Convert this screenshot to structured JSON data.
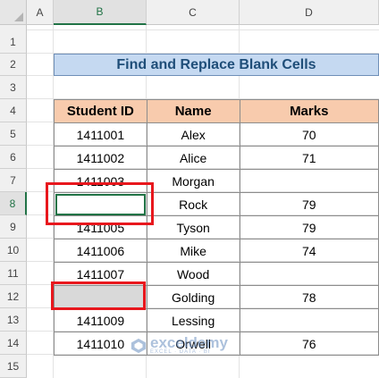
{
  "columns": [
    "A",
    "B",
    "C",
    "D"
  ],
  "rows": [
    "1",
    "2",
    "3",
    "4",
    "5",
    "6",
    "7",
    "8",
    "9",
    "10",
    "11",
    "12",
    "13",
    "14",
    "15"
  ],
  "title": "Find and Replace Blank Cells",
  "table": {
    "headers": [
      "Student ID",
      "Name",
      "Marks"
    ],
    "rows": [
      [
        "1411001",
        "Alex",
        "70"
      ],
      [
        "1411002",
        "Alice",
        "71"
      ],
      [
        "1411003",
        "Morgan",
        ""
      ],
      [
        "",
        "Rock",
        "79"
      ],
      [
        "1411005",
        "Tyson",
        "79"
      ],
      [
        "1411006",
        "Mike",
        "74"
      ],
      [
        "1411007",
        "Wood",
        ""
      ],
      [
        "",
        "Golding",
        "78"
      ],
      [
        "1411009",
        "Lessing",
        ""
      ],
      [
        "1411010",
        "Orwell",
        "76"
      ]
    ]
  },
  "watermark": {
    "name": "exceldemy",
    "tagline": "EXCEL · DATA · BI"
  },
  "colors": {
    "title_fill": "#c5d9f1",
    "header_fill": "#f8cbad",
    "highlight_box": "#e8171d",
    "selection": "#217346",
    "blank_fill": "#d9d9d9"
  }
}
